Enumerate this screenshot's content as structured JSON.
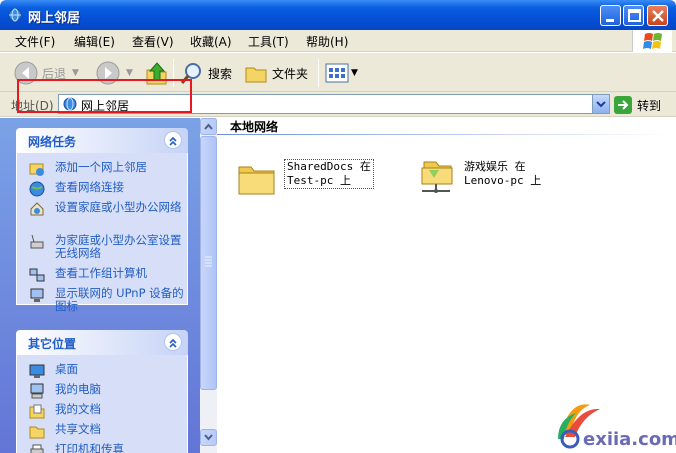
{
  "window": {
    "title": "网上邻居"
  },
  "menu": [
    "文件(F)",
    "编辑(E)",
    "查看(V)",
    "收藏(A)",
    "工具(T)",
    "帮助(H)"
  ],
  "toolbar": {
    "back_label": "后退",
    "search_label": "搜索",
    "folders_label": "文件夹"
  },
  "address": {
    "label": "地址(D)",
    "value": "网上邻居",
    "go_label": "转到"
  },
  "network_tasks": {
    "title": "网络任务",
    "items": [
      {
        "label": "添加一个网上邻居",
        "icon": "add-network-place-icon"
      },
      {
        "label": "查看网络连接",
        "icon": "network-connections-icon"
      },
      {
        "label": "设置家庭或小型办公网络",
        "icon": "home-network-setup-icon"
      },
      {
        "label": "为家庭或小型办公室设置无线网络",
        "icon": "wireless-setup-icon"
      },
      {
        "label": "查看工作组计算机",
        "icon": "workgroup-computers-icon"
      },
      {
        "label": "显示联网的 UPnP 设备的图标",
        "icon": "upnp-devices-icon"
      }
    ]
  },
  "other_places": {
    "title": "其它位置",
    "items": [
      {
        "label": "桌面",
        "icon": "desktop-icon"
      },
      {
        "label": "我的电脑",
        "icon": "my-computer-icon"
      },
      {
        "label": "我的文档",
        "icon": "my-documents-icon"
      },
      {
        "label": "共享文档",
        "icon": "shared-documents-icon"
      },
      {
        "label": "打印机和传真",
        "icon": "printer-icon"
      }
    ]
  },
  "content": {
    "group_title": "本地网络",
    "items": [
      {
        "label_line1": "SharedDocs 在",
        "label_line2": "Test-pc 上",
        "icon": "shared-folder-icon"
      },
      {
        "label_line1": "游戏娱乐 在",
        "label_line2": "Lenovo-pc 上",
        "icon": "network-share-folder-icon"
      }
    ]
  },
  "watermark": {
    "text": "exiia.com"
  },
  "colors": {
    "titlebar": "#0550d8",
    "task_link": "#215dc6",
    "highlight": "#e5191f",
    "pane_bg": "#6375d6"
  }
}
